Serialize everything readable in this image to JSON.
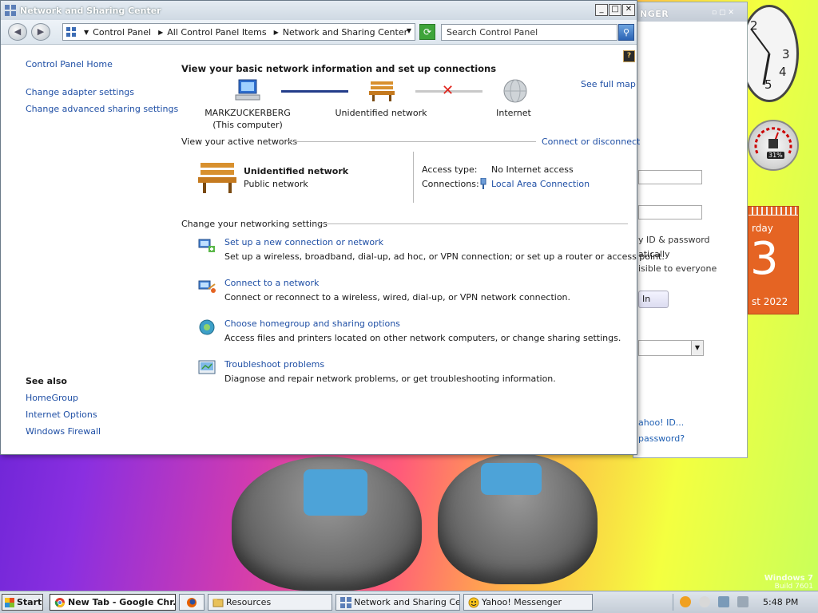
{
  "desktop": {
    "watermark_title": "Windows 7",
    "watermark_build": "Build 7601"
  },
  "gadgets": {
    "clock_numbers": [
      "2",
      "3",
      "4",
      "5"
    ],
    "meter_pct": "31%",
    "calendar_day": "rday",
    "calendar_date": "3",
    "calendar_month": "st 2022"
  },
  "messenger": {
    "title": "NGER",
    "controls": "▫ ▢ ✕",
    "remember": "y ID & password",
    "auto": "atically",
    "invisible": "isible to everyone",
    "signin_btn": "In",
    "link_id": "ahoo! ID...",
    "link_pw": "password?"
  },
  "window": {
    "title": "Network and Sharing Center",
    "btn_min": "_",
    "btn_max": "□",
    "btn_close": "✕",
    "nav_back": "◀",
    "nav_fwd": "▶",
    "breadcrumb": [
      "Control Panel",
      "All Control Panel Items",
      "Network and Sharing Center"
    ],
    "search_placeholder": "Search Control Panel",
    "refresh_glyph": "⟳",
    "search_glyph": "⚲",
    "help_glyph": "?"
  },
  "left_pane": {
    "home": "Control Panel Home",
    "links": [
      "Change adapter settings",
      "Change advanced sharing settings"
    ],
    "see_also_title": "See also",
    "see_also": [
      "HomeGroup",
      "Internet Options",
      "Windows Firewall"
    ]
  },
  "main": {
    "heading": "View your basic network information and set up connections",
    "see_full_map": "See full map",
    "nodes": [
      {
        "name": "MARKZUCKERBERG",
        "sub": "(This computer)"
      },
      {
        "name": "Unidentified network",
        "sub": ""
      },
      {
        "name": "Internet",
        "sub": ""
      }
    ],
    "active_networks_label": "View your active networks",
    "connect_disconnect": "Connect or disconnect",
    "network_name": "Unidentified network",
    "network_type": "Public network",
    "access_type_label": "Access type:",
    "access_type_value": "No Internet access",
    "connections_label": "Connections:",
    "connections_value": "Local Area Connection",
    "settings_label": "Change your networking settings",
    "settings": [
      {
        "title": "Set up a new connection or network",
        "desc": "Set up a wireless, broadband, dial-up, ad hoc, or VPN connection; or set up a router or access point."
      },
      {
        "title": "Connect to a network",
        "desc": "Connect or reconnect to a wireless, wired, dial-up, or VPN network connection."
      },
      {
        "title": "Choose homegroup and sharing options",
        "desc": "Access files and printers located on other network computers, or change sharing settings."
      },
      {
        "title": "Troubleshoot problems",
        "desc": "Diagnose and repair network problems, or get troubleshooting information."
      }
    ]
  },
  "taskbar": {
    "start": "Start",
    "tasks": [
      "New Tab - Google Chr...",
      "Resources",
      "Network and Sharing Ce...",
      "Yahoo! Messenger"
    ],
    "time": "5:48 PM"
  }
}
